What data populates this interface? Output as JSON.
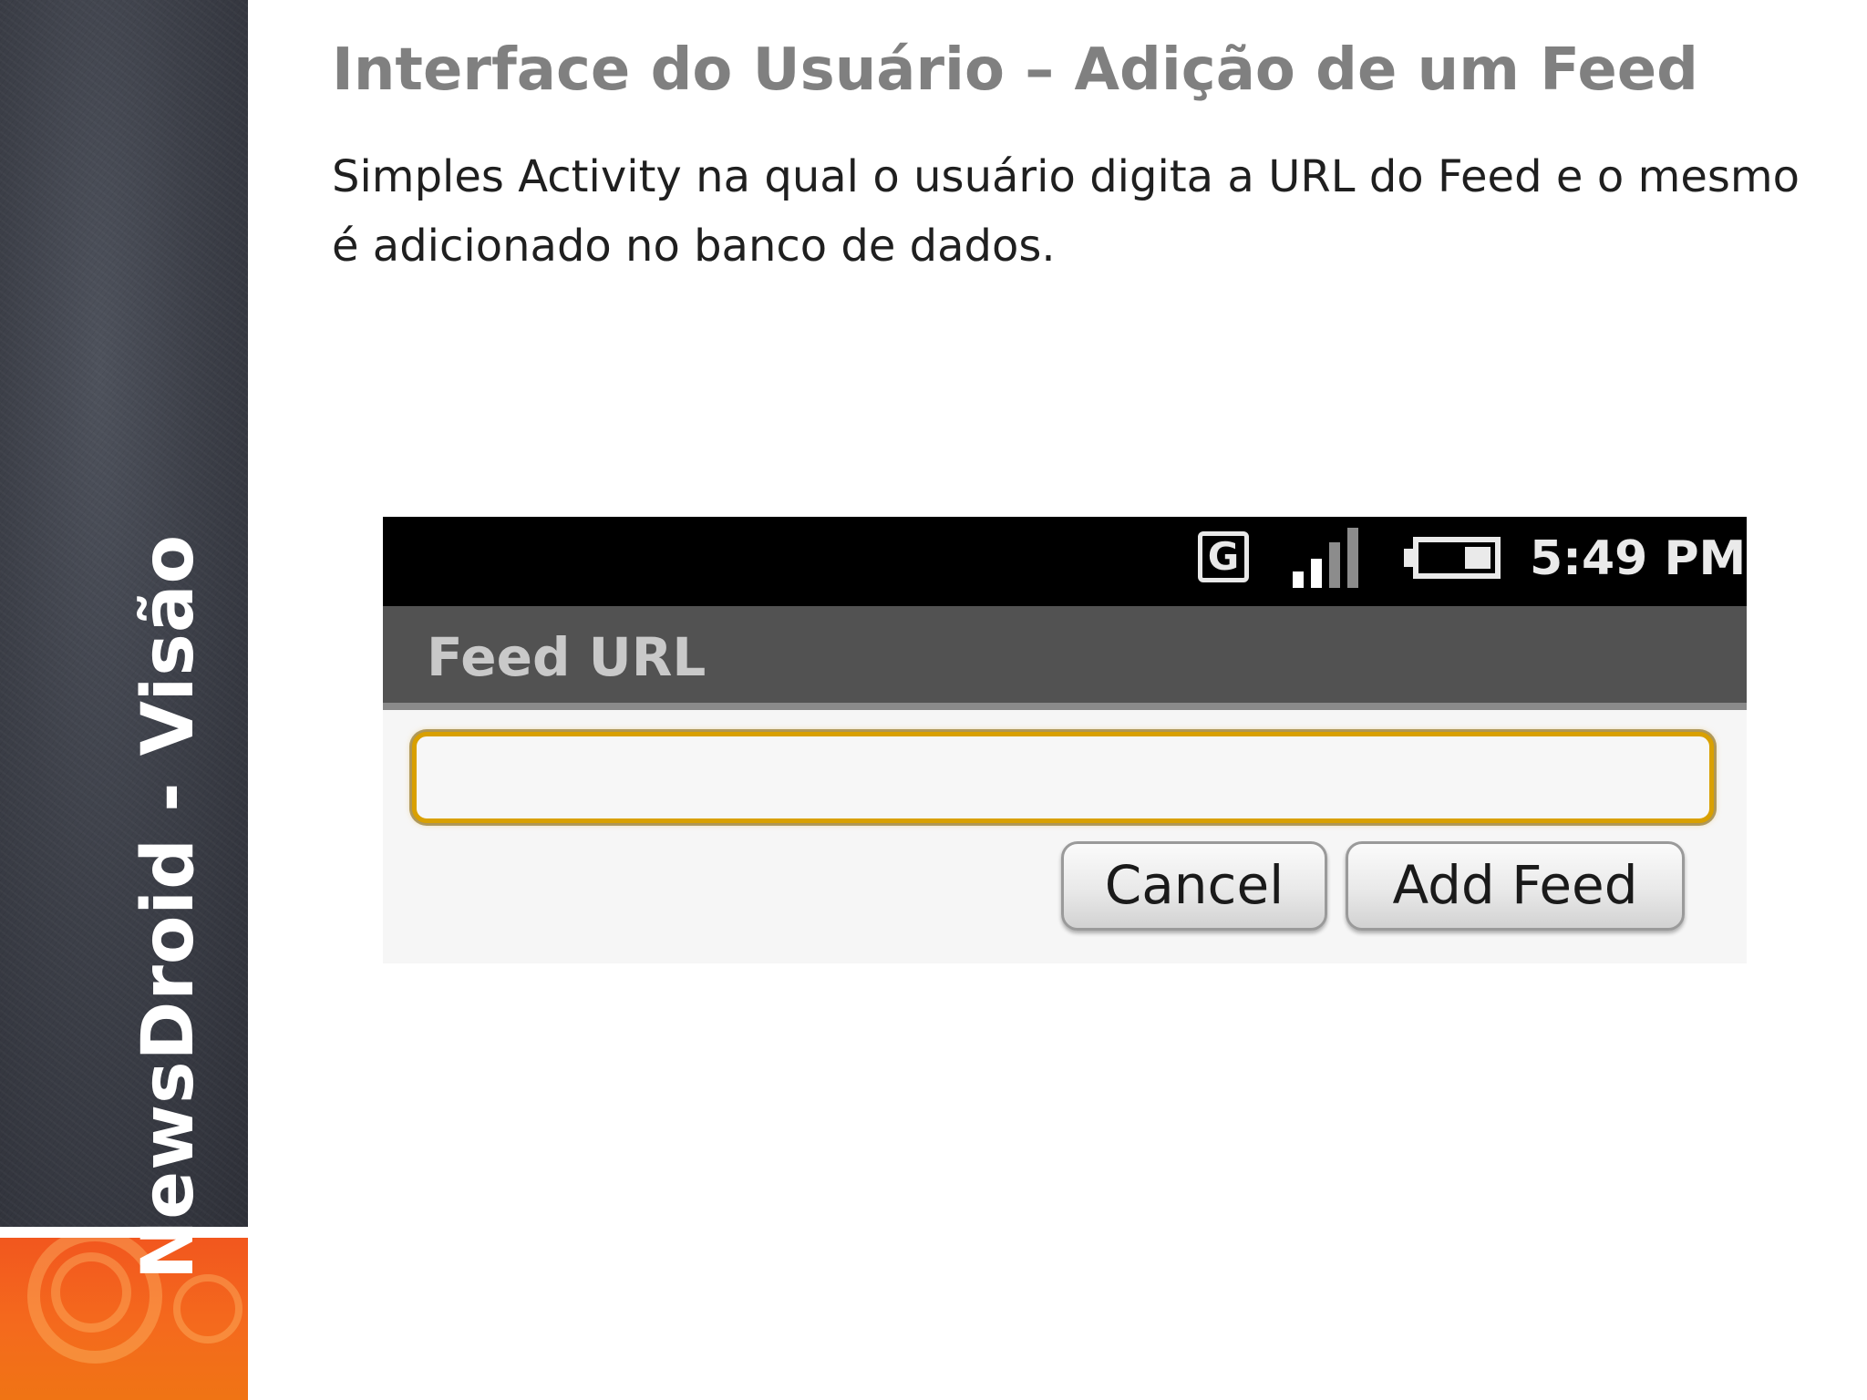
{
  "sidebar": {
    "vertical_title": "NewsDroid  - Visão"
  },
  "slide": {
    "title": "Interface do Usuário – Adição de um Feed",
    "body": "Simples Activity na qual o usuário digita a URL do Feed e o mesmo é adicionado no banco de dados."
  },
  "phone": {
    "status_bar": {
      "network_letter": "G",
      "network_icon": "g-network-icon",
      "signal_icon": "signal-bars-icon",
      "battery_icon": "battery-icon",
      "time": "5:49 PM"
    },
    "dialog": {
      "title": "Feed URL",
      "input_value": "",
      "cancel_label": "Cancel",
      "add_label": "Add Feed"
    }
  },
  "colors": {
    "title_gray": "#808080",
    "sidebar_dark": "#3d4049",
    "sidebar_orange": "#f46a1d",
    "input_focus": "#d9a000",
    "dialog_titlebar": "#525252"
  }
}
